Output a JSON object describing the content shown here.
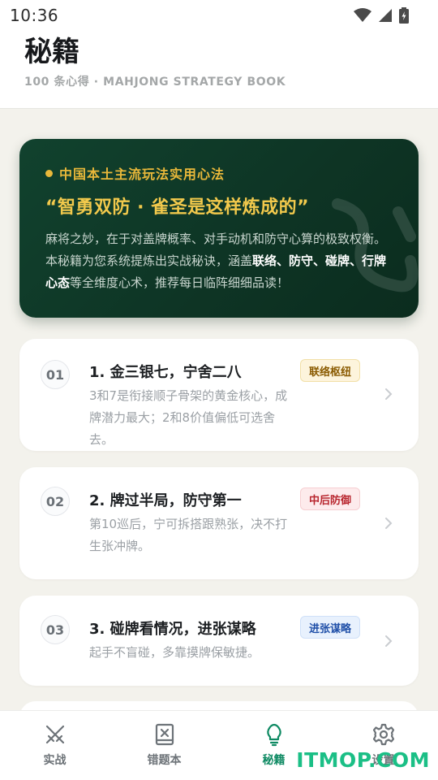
{
  "status_bar": {
    "time": "10:36",
    "icons": [
      "wifi-icon",
      "signal-icon",
      "battery-icon"
    ]
  },
  "header": {
    "title": "秘籍",
    "subtitle": "100 条心得 · MAHJONG STRATEGY BOOK"
  },
  "hero": {
    "eyebrow": "中国本土主流玩法实用心法",
    "heading": "“智勇双防 · 雀圣是这样炼成的”",
    "body_parts": [
      {
        "text": "麻将之妙，在于对盖牌概率、对手动机和防守心算的极致权衡。本秘籍为您系统提炼出实战秘诀，涵盖",
        "bold": false
      },
      {
        "text": "联络、防守、碰牌、行牌心态",
        "bold": true
      },
      {
        "text": "等全维度心术，推荐每日临阵细细品读！",
        "bold": false
      }
    ]
  },
  "strategies": [
    {
      "number": "01",
      "title": "1. 金三银七，宁舍二八",
      "tag": "联络枢纽",
      "tag_color": "gold",
      "description": "3和7是衔接顺子骨架的黄金核心，成牌潜力最大；2和8价值偏低可选舍去。"
    },
    {
      "number": "02",
      "title": "2. 牌过半局，防守第一",
      "tag": "中后防御",
      "tag_color": "red",
      "description": "第10巡后，宁可拆搭跟熟张，决不打生张冲牌。"
    },
    {
      "number": "03",
      "title": "3. 碰牌看情况，进张谋略",
      "tag": "进张谋略",
      "tag_color": "blue",
      "description": "起手不盲碰，多靠摸牌保敏捷。"
    }
  ],
  "bottom_nav": {
    "items": [
      {
        "label": "实战",
        "icon": "crossed-swords-icon",
        "active": false
      },
      {
        "label": "错题本",
        "icon": "notebook-x-icon",
        "active": false
      },
      {
        "label": "秘籍",
        "icon": "lightbulb-icon",
        "active": true
      },
      {
        "label": "设置",
        "icon": "gear-icon",
        "active": false
      }
    ]
  },
  "watermark": "ITMOP.COM",
  "colors": {
    "accent": "#0f8a63",
    "hero_bg": "#11422e",
    "hero_gold": "#f2c94c",
    "page_bg": "#f3f2ec"
  }
}
